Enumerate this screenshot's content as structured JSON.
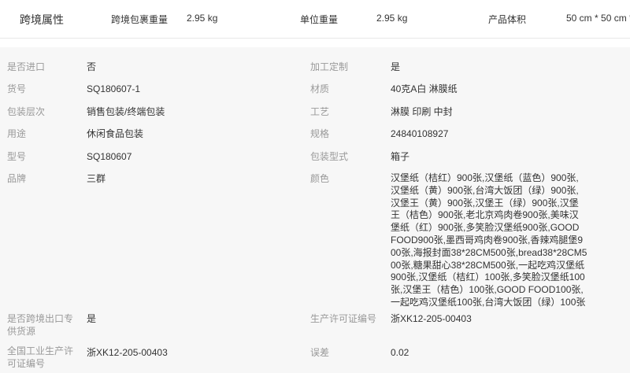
{
  "header": {
    "title": "跨境属性",
    "pkg_weight_label": "跨境包裹重量",
    "pkg_weight_value": "2.95 kg",
    "unit_weight_label": "单位重量",
    "unit_weight_value": "2.95 kg",
    "volume_label": "产品体积",
    "volume_value": "50 cm * 50 cm *"
  },
  "left": [
    {
      "label": "是否进口",
      "value": "否"
    },
    {
      "label": "货号",
      "value": "SQ180607-1"
    },
    {
      "label": "包装层次",
      "value": "销售包装/终端包装"
    },
    {
      "label": "用途",
      "value": "休闲食品包装"
    },
    {
      "label": "型号",
      "value": "SQ180607"
    },
    {
      "label": "品牌",
      "value": "三群"
    },
    {
      "label": "是否跨境出口专供货源",
      "value": "是"
    },
    {
      "label": "全国工业生产许可证编号",
      "value": "浙XK12-205-00403"
    }
  ],
  "right": [
    {
      "label": "加工定制",
      "value": "是"
    },
    {
      "label": "材质",
      "value": "40克A白 淋膜纸"
    },
    {
      "label": "工艺",
      "value": "淋膜 印刷 中封"
    },
    {
      "label": "规格",
      "value": "24840108927"
    },
    {
      "label": "包装型式",
      "value": "箱子"
    },
    {
      "label": "颜色",
      "value": "汉堡纸（桔红）900张,汉堡纸（蓝色）900张,汉堡纸（黄）900张,台湾大饭团（绿）900张,汉堡王（黄）900张,汉堡王（绿）900张,汉堡王（桔色）900张,老北京鸡肉卷900张,美味汉堡纸（红）900张,多笑脸汉堡纸900张,GOOD FOOD900张,墨西哥鸡肉卷900张,香辣鸡腿堡900张,海报封面38*28CM500张,bread38*28CM500张,糖果甜心38*28CM500张,一起吃鸡汉堡纸900张,汉堡纸（桔红）100张,多笑脸汉堡纸100张,汉堡王（桔色）100张,GOOD FOOD100张,一起吃鸡汉堡纸100张,台湾大饭团（绿）100张"
    },
    {
      "label": "生产许可证编号",
      "value": "浙XK12-205-00403"
    },
    {
      "label": "误差",
      "value": "0.02"
    }
  ]
}
